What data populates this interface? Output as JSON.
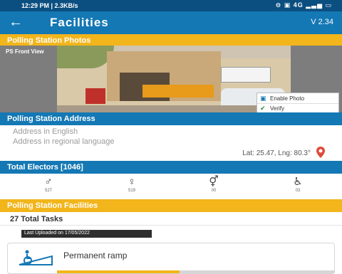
{
  "status_bar": {
    "time": "12:29 PM | 2.3KB/s",
    "icons": "⊖ ▣ 4G ▂▃▅ ▭"
  },
  "app_bar": {
    "back_icon": "arrow-left-icon",
    "title": "Facilities",
    "version": "V 2.34"
  },
  "sections": {
    "photos": "Polling Station Photos",
    "address": "Polling Station Address",
    "electors": "Total Electors [1046]",
    "facilities": "Polling Station Facilities"
  },
  "photo": {
    "label": "PS Front View",
    "menu": [
      {
        "icon": "gallery-icon",
        "label": "Enable Photo"
      },
      {
        "icon": "check-icon",
        "label": "Verify"
      }
    ]
  },
  "address": {
    "english_placeholder": "Address in English",
    "regional_placeholder": "Address in regional language",
    "latlng": "Lat: 25.47, Lng: 80.3°"
  },
  "electors": [
    {
      "icon": "male-icon",
      "count": "527"
    },
    {
      "icon": "female-icon",
      "count": "519"
    },
    {
      "icon": "third-gender-icon",
      "count": "00"
    },
    {
      "icon": "wheelchair-icon",
      "count": "03"
    }
  ],
  "tasks": {
    "title": "27 Total Tasks",
    "last_upload": "Last Uploaded on 17/05/2022",
    "facility_label": "Permanent ramp",
    "progress": 0.44
  },
  "colors": {
    "primary": "#1478b4",
    "accent": "#f2b51b",
    "status": "#0b4f80"
  }
}
